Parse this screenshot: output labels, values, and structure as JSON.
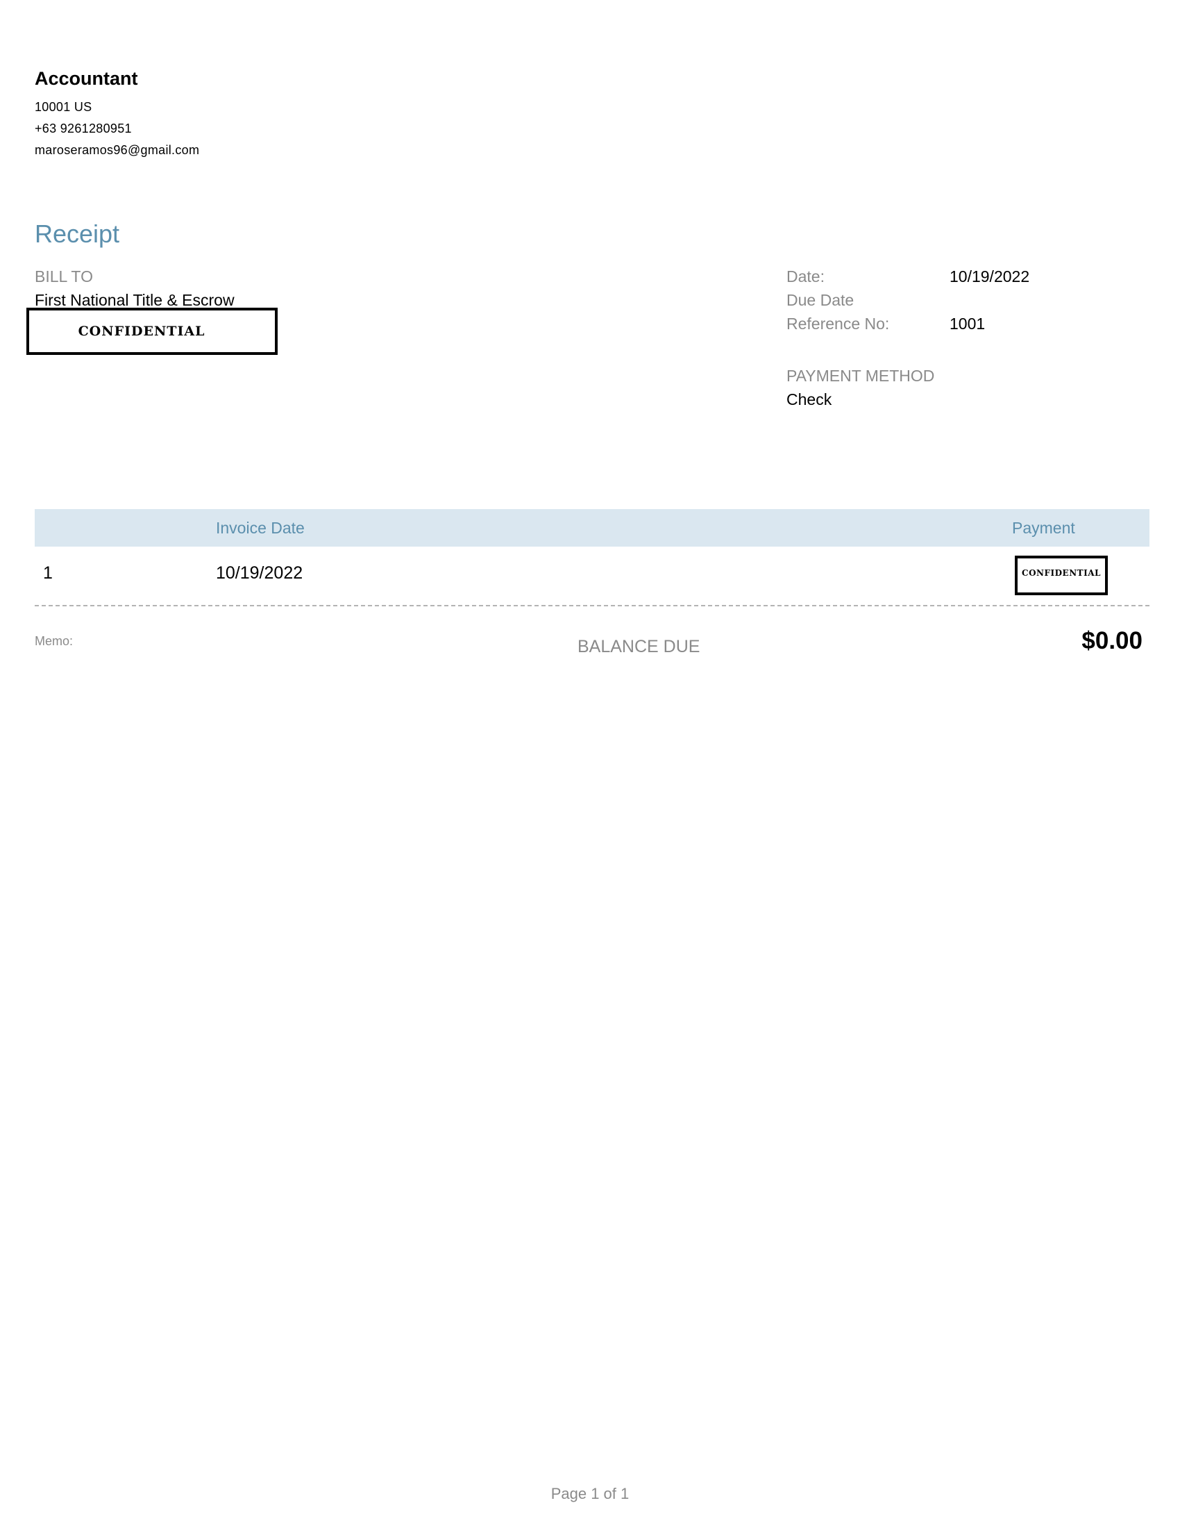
{
  "company": {
    "name": "Accountant",
    "address": "10001 US",
    "phone": "+63 9261280951",
    "email": "maroseramos96@gmail.com"
  },
  "document": {
    "title": "Receipt"
  },
  "bill_to": {
    "label": "BILL TO",
    "name": "First National Title & Escrow",
    "redaction": "CONFIDENTIAL"
  },
  "details": {
    "date_label": "Date:",
    "date_value": "10/19/2022",
    "due_date_label": "Due Date",
    "due_date_value": "",
    "reference_label": "Reference No:",
    "reference_value": "1001",
    "payment_method_label": "PAYMENT METHOD",
    "payment_method_value": "Check"
  },
  "table": {
    "headers": {
      "number": "",
      "invoice_date": "Invoice Date",
      "payment": "Payment"
    },
    "rows": [
      {
        "number": "1",
        "invoice_date": "10/19/2022",
        "payment": "CONFIDENTIAL"
      }
    ]
  },
  "summary": {
    "memo_label": "Memo:",
    "balance_due_label": "BALANCE DUE",
    "balance_due_value": "$0.00"
  },
  "footer": {
    "page": "Page 1 of 1"
  }
}
